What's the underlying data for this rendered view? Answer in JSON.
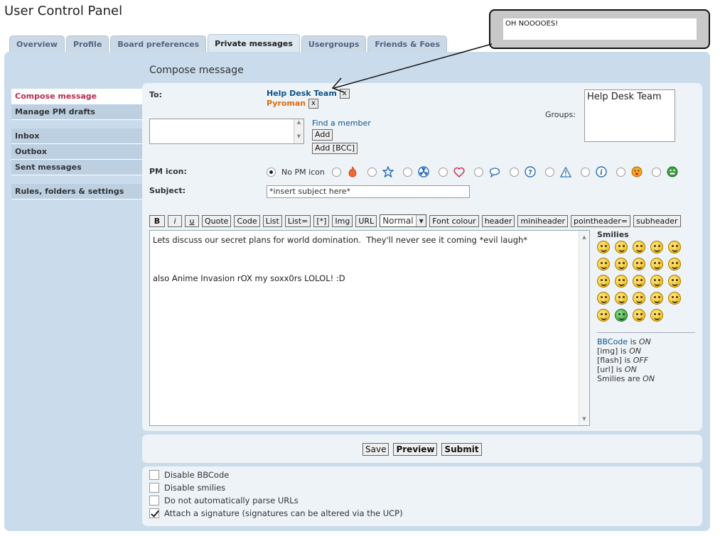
{
  "page_title": "User Control Panel",
  "tabs": [
    {
      "label": "Overview",
      "active": false
    },
    {
      "label": "Profile",
      "active": false
    },
    {
      "label": "Board preferences",
      "active": false
    },
    {
      "label": "Private messages",
      "active": true
    },
    {
      "label": "Usergroups",
      "active": false
    },
    {
      "label": "Friends & Foes",
      "active": false
    }
  ],
  "compose_title": "Compose message",
  "sidebar": {
    "items": [
      {
        "label": "Compose message",
        "active": true
      },
      {
        "label": "Manage PM drafts",
        "active": false
      },
      {
        "label": "Inbox",
        "active": false
      },
      {
        "label": "Outbox",
        "active": false
      },
      {
        "label": "Sent messages",
        "active": false
      },
      {
        "label": "Rules, folders & settings",
        "active": false
      }
    ]
  },
  "form": {
    "to_label": "To:",
    "recipients": [
      {
        "name": "Help Desk Team",
        "type": "group",
        "remove": "x"
      },
      {
        "name": "Pyroman",
        "type": "user",
        "remove": "x"
      }
    ],
    "find_member": "Find a member",
    "add_label": "Add",
    "add_bcc_label": "Add [BCC]",
    "groups_label": "Groups:",
    "groups_list": [
      "Help Desk Team"
    ],
    "pm_icon_label": "PM icon:",
    "no_pm_icon": "No PM icon",
    "pm_icons": [
      "fire-icon",
      "star-icon",
      "radioactive-icon",
      "heart-icon",
      "speech-bubble-icon",
      "question-icon",
      "warning-icon",
      "info-icon",
      "mad-smiley-icon",
      "grin-smiley-icon"
    ],
    "subject_label": "Subject:",
    "subject_value": "*insert subject here*"
  },
  "toolbar": {
    "buttons": [
      "B",
      "i",
      "u",
      "Quote",
      "Code",
      "List",
      "List=",
      "[*]",
      "Img",
      "URL"
    ],
    "font_size_selected": "Normal",
    "extra_buttons": [
      "Font colour",
      "header",
      "miniheader",
      "pointheader=",
      "subheader"
    ]
  },
  "message": {
    "lines": [
      "Lets discuss our secret plans for world domination.  They'll never see it coming *evil laugh*",
      "",
      "",
      "also Anime Invasion rOX my soxx0rs LOLOL! :D"
    ]
  },
  "smilies": {
    "title": "Smilies",
    "count": 24
  },
  "bbcode_info": {
    "bbcode_link": "BBCode",
    "bbcode_is": "is",
    "bbcode_state": "ON",
    "img_label": "[img] is",
    "img_state": "ON",
    "flash_label": "[flash] is",
    "flash_state": "OFF",
    "url_label": "[url] is",
    "url_state": "ON",
    "smilies_label": "Smilies are",
    "smilies_state": "ON"
  },
  "actions": {
    "save": "Save",
    "preview": "Preview",
    "submit": "Submit"
  },
  "options": [
    {
      "label": "Disable BBCode",
      "checked": false
    },
    {
      "label": "Disable smilies",
      "checked": false
    },
    {
      "label": "Do not automatically parse URLs",
      "checked": false
    },
    {
      "label": "Attach a signature (signatures can be altered via the UCP)",
      "checked": true
    }
  ],
  "annotation": {
    "bubble_text": "OH NOOOOES!"
  }
}
